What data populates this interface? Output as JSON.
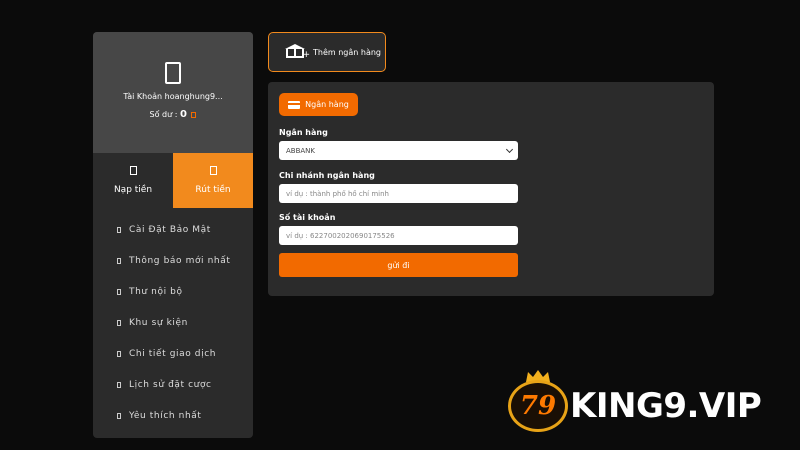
{
  "sidebar": {
    "account_label": "Tài Khoản hoanghung9...",
    "balance_label": "Số dư :",
    "balance_value": "0",
    "tabs": {
      "deposit": "Nạp tiền",
      "withdraw": "Rút tiền"
    },
    "menu": [
      "Cài Đặt Bảo Mật",
      "Thông báo mới nhất",
      "Thư nội bộ",
      "Khu sự kiện",
      "Chi tiết giao dịch",
      "Lịch sử đặt cược",
      "Yêu thích nhất"
    ]
  },
  "toolbar": {
    "add_bank_label": "Thêm ngân hàng"
  },
  "form": {
    "section_label": "Ngân hàng",
    "bank_label": "Ngân hàng",
    "bank_selected": "ABBANK",
    "branch_label": "Chi nhánh ngân hàng",
    "branch_placeholder": "ví dụ : thành phố hồ chí minh",
    "account_label": "Số tài khoản",
    "account_placeholder": "ví dụ : 6227002020690175526",
    "submit_label": "gửi đi"
  },
  "brand": {
    "logo_number": "79",
    "logo_text": "KING9.VIP"
  },
  "colors": {
    "accent": "#f26a00",
    "tab_active": "#f28a1d",
    "background": "#0b0b0b",
    "panel": "#2b2b2b"
  }
}
